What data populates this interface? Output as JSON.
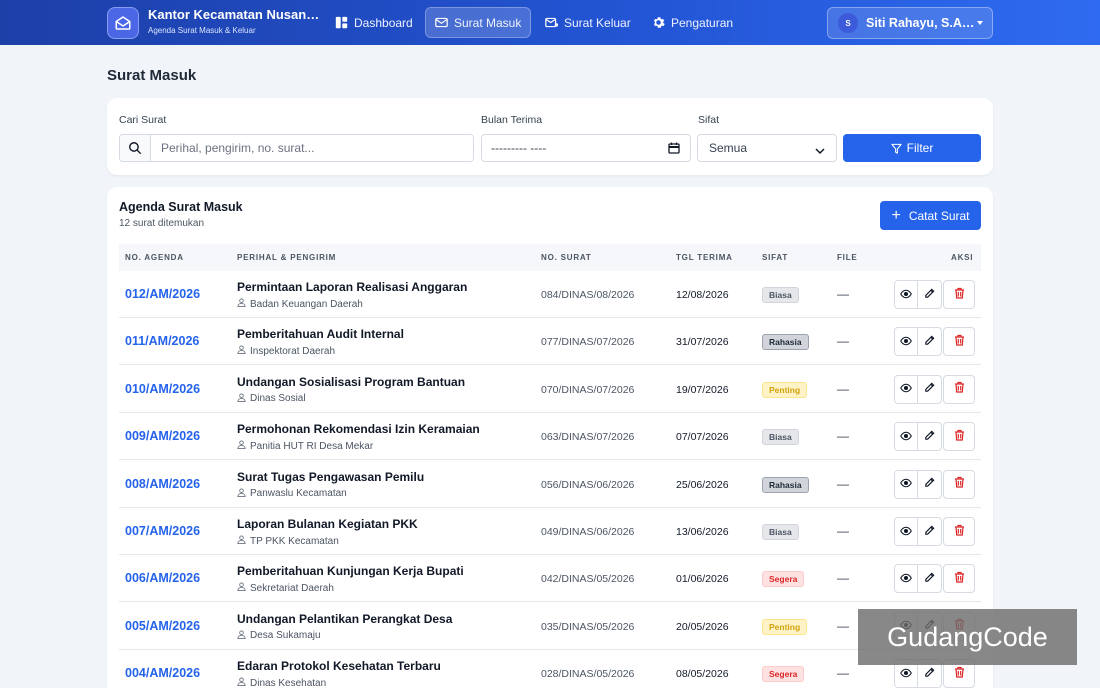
{
  "app": {
    "title": "Kantor Kecamatan Nusan…",
    "subtitle": "Agenda Surat Masuk & Keluar"
  },
  "nav": [
    {
      "label": "Dashboard",
      "icon": "dashboard-icon",
      "active": false
    },
    {
      "label": "Surat Masuk",
      "icon": "inbox-mail-icon",
      "active": true
    },
    {
      "label": "Surat Keluar",
      "icon": "outbox-mail-icon",
      "active": false
    },
    {
      "label": "Pengaturan",
      "icon": "gear-icon",
      "active": false
    }
  ],
  "user": {
    "initial": "S",
    "name": "Siti Rahayu, S.A…"
  },
  "page_title": "Surat Masuk",
  "filters": {
    "search_label": "Cari Surat",
    "search_placeholder": "Perihal, pengirim, no. surat...",
    "month_label": "Bulan Terima",
    "month_value": "--------- ----",
    "sifat_label": "Sifat",
    "sifat_value": "Semua",
    "filter_button": "Filter"
  },
  "table": {
    "title": "Agenda Surat Masuk",
    "count_text": "12 surat ditemukan",
    "add_button": "Catat Surat",
    "headers": [
      "NO. AGENDA",
      "PERIHAL & PENGIRIM",
      "NO. SURAT",
      "TGL TERIMA",
      "SIFAT",
      "FILE",
      "AKSI"
    ],
    "rows": [
      {
        "agenda": "012/AM/2026",
        "perihal": "Permintaan Laporan Realisasi Anggaran",
        "pengirim": "Badan Keuangan Daerah",
        "no_surat": "084/DINAS/08/2026",
        "tgl": "12/08/2026",
        "sifat": "Biasa",
        "file": "—"
      },
      {
        "agenda": "011/AM/2026",
        "perihal": "Pemberitahuan Audit Internal",
        "pengirim": "Inspektorat Daerah",
        "no_surat": "077/DINAS/07/2026",
        "tgl": "31/07/2026",
        "sifat": "Rahasia",
        "file": "—"
      },
      {
        "agenda": "010/AM/2026",
        "perihal": "Undangan Sosialisasi Program Bantuan",
        "pengirim": "Dinas Sosial",
        "no_surat": "070/DINAS/07/2026",
        "tgl": "19/07/2026",
        "sifat": "Penting",
        "file": "—"
      },
      {
        "agenda": "009/AM/2026",
        "perihal": "Permohonan Rekomendasi Izin Keramaian",
        "pengirim": "Panitia HUT RI Desa Mekar",
        "no_surat": "063/DINAS/07/2026",
        "tgl": "07/07/2026",
        "sifat": "Biasa",
        "file": "—"
      },
      {
        "agenda": "008/AM/2026",
        "perihal": "Surat Tugas Pengawasan Pemilu",
        "pengirim": "Panwaslu Kecamatan",
        "no_surat": "056/DINAS/06/2026",
        "tgl": "25/06/2026",
        "sifat": "Rahasia",
        "file": "—"
      },
      {
        "agenda": "007/AM/2026",
        "perihal": "Laporan Bulanan Kegiatan PKK",
        "pengirim": "TP PKK Kecamatan",
        "no_surat": "049/DINAS/06/2026",
        "tgl": "13/06/2026",
        "sifat": "Biasa",
        "file": "—"
      },
      {
        "agenda": "006/AM/2026",
        "perihal": "Pemberitahuan Kunjungan Kerja Bupati",
        "pengirim": "Sekretariat Daerah",
        "no_surat": "042/DINAS/05/2026",
        "tgl": "01/06/2026",
        "sifat": "Segera",
        "file": "—"
      },
      {
        "agenda": "005/AM/2026",
        "perihal": "Undangan Pelantikan Perangkat Desa",
        "pengirim": "Desa Sukamaju",
        "no_surat": "035/DINAS/05/2026",
        "tgl": "20/05/2026",
        "sifat": "Penting",
        "file": "—"
      },
      {
        "agenda": "004/AM/2026",
        "perihal": "Edaran Protokol Kesehatan Terbaru",
        "pengirim": "Dinas Kesehatan",
        "no_surat": "028/DINAS/05/2026",
        "tgl": "08/05/2026",
        "sifat": "Segera",
        "file": "—"
      }
    ]
  },
  "badge_colors": {
    "Biasa": {
      "bg": "#e5e7eb",
      "fg": "#4b5563",
      "border": "#d1d5db"
    },
    "Rahasia": {
      "bg": "#d1d5db",
      "fg": "#1f2937",
      "border": "#9ca3af"
    },
    "Penting": {
      "bg": "#fef3c7",
      "fg": "#d4a20b",
      "border": "#fde68a"
    },
    "Segera": {
      "bg": "#fee2e2",
      "fg": "#dc2626",
      "border": "#fecaca"
    }
  },
  "watermark": "GudangCode"
}
